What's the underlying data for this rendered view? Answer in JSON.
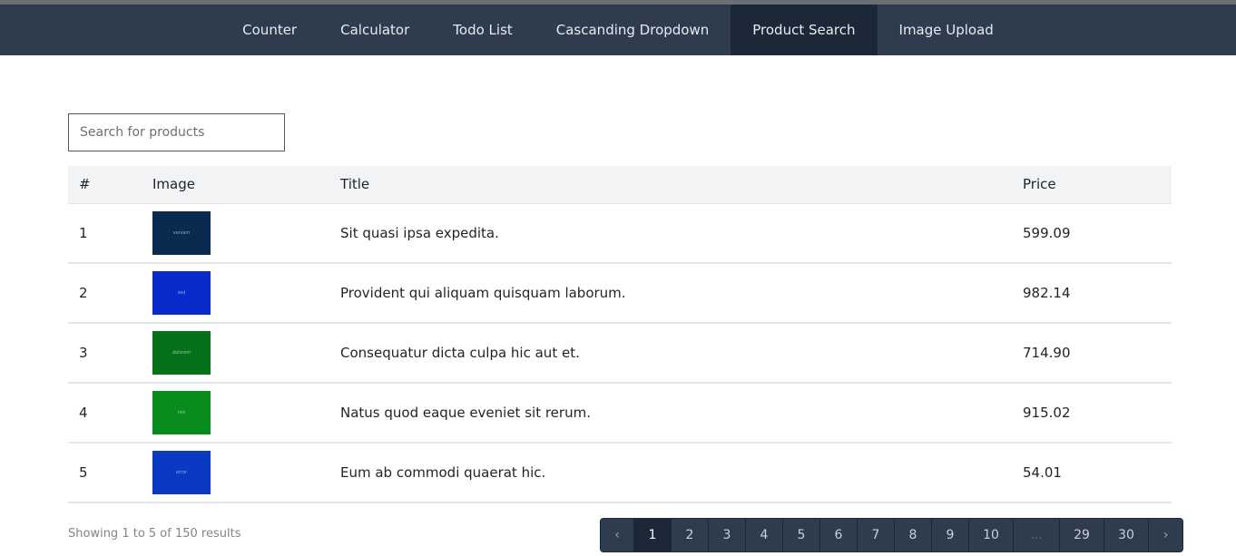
{
  "nav": {
    "items": [
      {
        "label": "Counter"
      },
      {
        "label": "Calculator"
      },
      {
        "label": "Todo List"
      },
      {
        "label": "Cascanding Dropdown"
      },
      {
        "label": "Product Search"
      },
      {
        "label": "Image Upload"
      }
    ],
    "active_index": 4
  },
  "search": {
    "placeholder": "Search for products",
    "value": ""
  },
  "table": {
    "headers": {
      "num": "#",
      "image": "Image",
      "title": "Title",
      "price": "Price"
    },
    "rows": [
      {
        "num": "1",
        "image_text": "veniam",
        "image_color": "#0a2a4f",
        "title": "Sit quasi ipsa expedita.",
        "price": "599.09"
      },
      {
        "num": "2",
        "image_text": "sed",
        "image_color": "#0a2bcc",
        "title": "Provident qui aliquam quisquam laborum.",
        "price": "982.14"
      },
      {
        "num": "3",
        "image_text": "dolorem",
        "image_color": "#06701b",
        "title": "Consequatur dicta culpa hic aut et.",
        "price": "714.90"
      },
      {
        "num": "4",
        "image_text": "nisi",
        "image_color": "#078c1d",
        "title": "Natus quod eaque eveniet sit rerum.",
        "price": "915.02"
      },
      {
        "num": "5",
        "image_text": "error",
        "image_color": "#0b3ac2",
        "title": "Eum ab commodi quaerat hic.",
        "price": "54.01"
      }
    ]
  },
  "footer": {
    "summary": "Showing 1 to 5 of 150 results"
  },
  "pagination": {
    "prev_icon": "chevron-left-icon",
    "next_icon": "chevron-right-icon",
    "prev_glyph": "‹",
    "next_glyph": "›",
    "pages": [
      "1",
      "2",
      "3",
      "4",
      "5",
      "6",
      "7",
      "8",
      "9",
      "10",
      "...",
      "29",
      "30"
    ],
    "current": "1"
  },
  "colors": {
    "nav_bg": "#2f3c4d",
    "nav_active": "#1c2737",
    "header_bg": "#f2f3f5"
  }
}
